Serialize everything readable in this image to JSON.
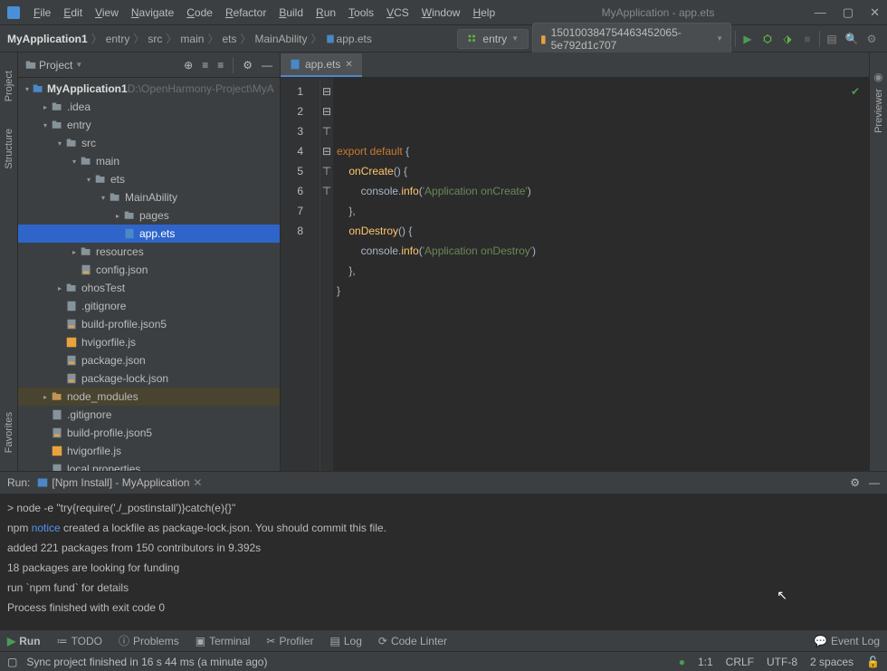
{
  "title": "MyApplication - app.ets",
  "menus": [
    "File",
    "Edit",
    "View",
    "Navigate",
    "Code",
    "Refactor",
    "Build",
    "Run",
    "Tools",
    "VCS",
    "Window",
    "Help"
  ],
  "breadcrumb": [
    "MyApplication1",
    "entry",
    "src",
    "main",
    "ets",
    "MainAbility",
    "app.ets"
  ],
  "runConfig": "entry",
  "device": "150100384754463452065­5e792d1c707",
  "projectLabel": "Project",
  "tree": {
    "root": "MyApplication1",
    "rootPath": " D:\\OpenHarmony-Project\\MyA",
    "items": [
      {
        "d": 1,
        "ar": "▸",
        "t": "folder",
        "l": ".idea"
      },
      {
        "d": 1,
        "ar": "▾",
        "t": "folder",
        "l": "entry"
      },
      {
        "d": 2,
        "ar": "▾",
        "t": "folder",
        "l": "src"
      },
      {
        "d": 3,
        "ar": "▾",
        "t": "folder",
        "l": "main"
      },
      {
        "d": 4,
        "ar": "▾",
        "t": "folder",
        "l": "ets"
      },
      {
        "d": 5,
        "ar": "▾",
        "t": "folder",
        "l": "MainAbility"
      },
      {
        "d": 6,
        "ar": "▸",
        "t": "folder",
        "l": "pages"
      },
      {
        "d": 6,
        "ar": "",
        "t": "ets",
        "l": "app.ets",
        "sel": true
      },
      {
        "d": 3,
        "ar": "▸",
        "t": "folder",
        "l": "resources"
      },
      {
        "d": 3,
        "ar": "",
        "t": "json",
        "l": "config.json"
      },
      {
        "d": 2,
        "ar": "▸",
        "t": "folder",
        "l": "ohosTest"
      },
      {
        "d": 2,
        "ar": "",
        "t": "file",
        "l": ".gitignore"
      },
      {
        "d": 2,
        "ar": "",
        "t": "json",
        "l": "build-profile.json5"
      },
      {
        "d": 2,
        "ar": "",
        "t": "js",
        "l": "hvigorfile.js"
      },
      {
        "d": 2,
        "ar": "",
        "t": "json",
        "l": "package.json"
      },
      {
        "d": 2,
        "ar": "",
        "t": "json",
        "l": "package-lock.json"
      },
      {
        "d": 1,
        "ar": "▸",
        "t": "folder-y",
        "l": "node_modules",
        "hl": true
      },
      {
        "d": 1,
        "ar": "",
        "t": "file",
        "l": ".gitignore"
      },
      {
        "d": 1,
        "ar": "",
        "t": "json",
        "l": "build-profile.json5"
      },
      {
        "d": 1,
        "ar": "",
        "t": "js",
        "l": "hvigorfile.js"
      },
      {
        "d": 1,
        "ar": "",
        "t": "file",
        "l": "local.properties"
      }
    ]
  },
  "editor": {
    "tab": "app.ets",
    "lines": [
      {
        "n": 1,
        "raw": "export default {",
        "tokens": [
          [
            "kw",
            "export default "
          ],
          [
            "p",
            "{"
          ]
        ]
      },
      {
        "n": 2,
        "raw": "    onCreate() {",
        "tokens": [
          [
            "p",
            "    "
          ],
          [
            "fn",
            "onCreate"
          ],
          [
            "p",
            "() {"
          ]
        ]
      },
      {
        "n": 3,
        "raw": "        console.info('Application onCreate')",
        "tokens": [
          [
            "p",
            "        console."
          ],
          [
            "fn",
            "info"
          ],
          [
            "p",
            "("
          ],
          [
            "str",
            "'Application onCreate'"
          ],
          [
            "p",
            ")"
          ]
        ]
      },
      {
        "n": 4,
        "raw": "    },",
        "tokens": [
          [
            "p",
            "    },"
          ]
        ]
      },
      {
        "n": 5,
        "raw": "    onDestroy() {",
        "tokens": [
          [
            "p",
            "    "
          ],
          [
            "fn",
            "onDestroy"
          ],
          [
            "p",
            "() {"
          ]
        ]
      },
      {
        "n": 6,
        "raw": "        console.info('Application onDestroy')",
        "tokens": [
          [
            "p",
            "        console."
          ],
          [
            "fn",
            "info"
          ],
          [
            "p",
            "("
          ],
          [
            "str",
            "'Application onDestroy'"
          ],
          [
            "p",
            ")"
          ]
        ]
      },
      {
        "n": 7,
        "raw": "    },",
        "tokens": [
          [
            "p",
            "    },"
          ]
        ]
      },
      {
        "n": 8,
        "raw": "}",
        "tokens": [
          [
            "p",
            "}"
          ]
        ]
      }
    ]
  },
  "run": {
    "label": "Run:",
    "tab": "[Npm Install] - MyApplication",
    "out": [
      "> node -e \"try{require('./_postinstall')}catch(e){}\"",
      "npm |notice| created a lockfile as package-lock.json. You should commit this file.",
      "added 221 packages from 150 contributors in 9.392s",
      "18 packages are looking for funding",
      "  run `npm fund` for details",
      "Process finished with exit code 0"
    ]
  },
  "bottom": {
    "run": "Run",
    "todo": "TODO",
    "problems": "Problems",
    "terminal": "Terminal",
    "profiler": "Profiler",
    "log": "Log",
    "codelinter": "Code Linter",
    "eventlog": "Event Log"
  },
  "status": {
    "msg": "Sync project finished in 16 s 44 ms (a minute ago)",
    "pos": "1:1",
    "enc": "CRLF",
    "charset": "UTF-8",
    "indent": "2 spaces"
  }
}
